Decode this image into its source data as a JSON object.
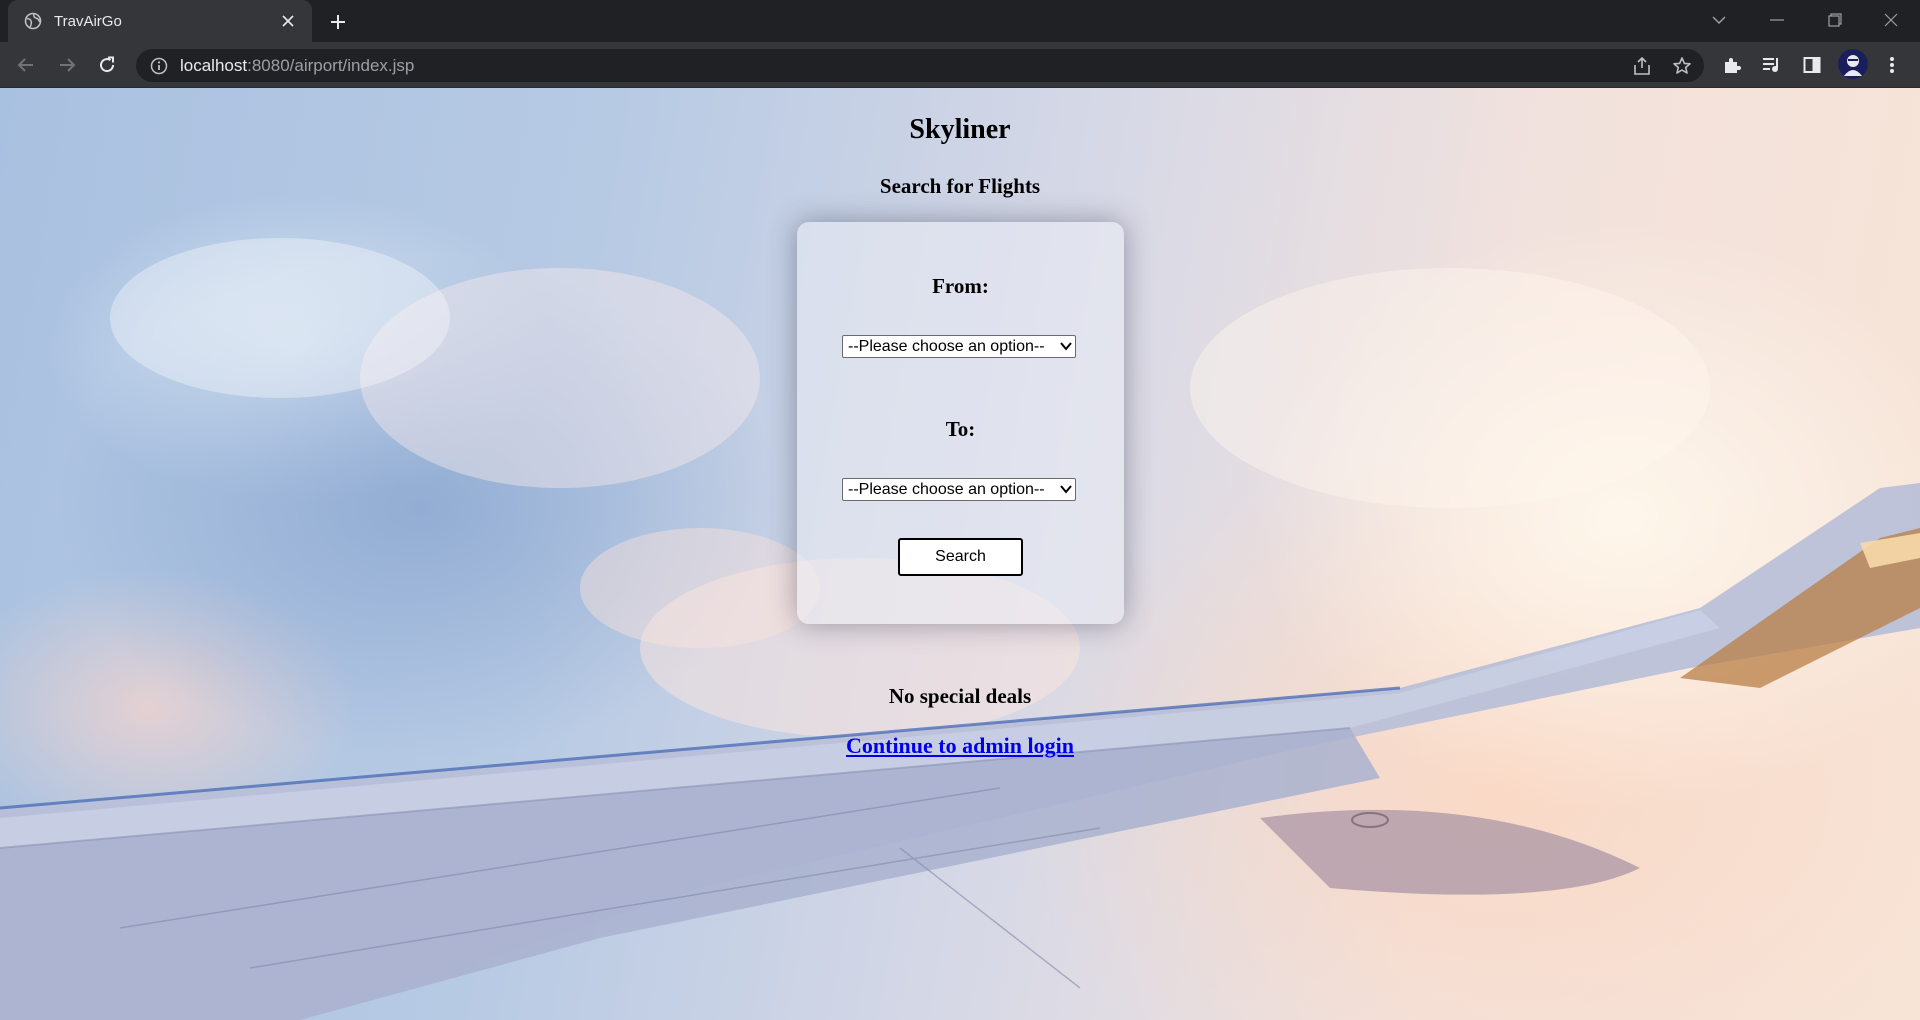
{
  "browser": {
    "tab_title": "TravAirGo",
    "url_host": "localhost",
    "url_rest": ":8080/airport/index.jsp"
  },
  "page": {
    "site_title": "Skyliner",
    "subtitle": "Search for Flights",
    "form": {
      "from_label": "From:",
      "from_selected": "--Please choose an option--",
      "to_label": "To:",
      "to_selected": "--Please choose an option--",
      "search_label": "Search"
    },
    "deals_text": "No special deals",
    "admin_link_text": "Continue to admin login"
  },
  "colors": {
    "chrome_dark": "#202124",
    "chrome_toolbar": "#35363a",
    "link": "#0000ee"
  }
}
